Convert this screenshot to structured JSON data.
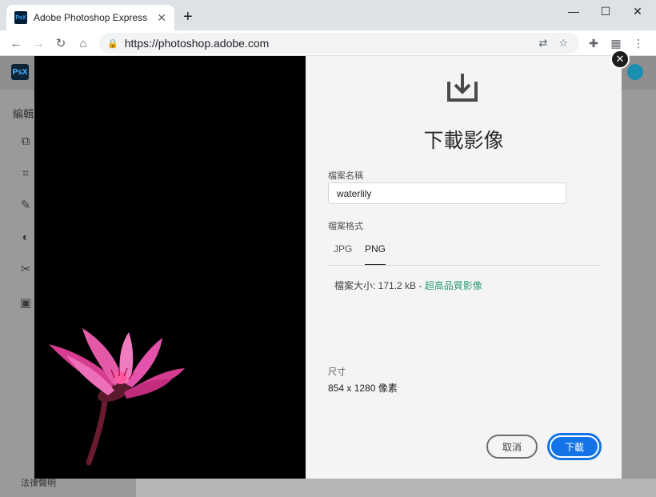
{
  "browser": {
    "tab_title": "Adobe Photoshop Express",
    "tab_favicon": "PsX",
    "new_tab": "+",
    "url": "https://photoshop.adobe.com",
    "window_controls": [
      "minimize-icon",
      "maximize-icon",
      "close-icon"
    ]
  },
  "app": {
    "logo": "PsX",
    "sidebar_heading": "編輯",
    "sidebar_icons": [
      "transform-icon",
      "crop-icon",
      "heal-icon",
      "adjust-icon",
      "cut-icon",
      "image-icon"
    ],
    "legal": "法律聲明"
  },
  "dialog": {
    "title": "下載影像",
    "filename_label": "檔案名稱",
    "filename_value": "waterlily",
    "format_label": "檔案格式",
    "formats": [
      "JPG",
      "PNG"
    ],
    "selected_format": "PNG",
    "size_label": "檔案大小: 171.2 kB - ",
    "size_quality": "超高品質影像",
    "dimensions_label": "尺寸",
    "dimensions_value": "854 x 1280 像素",
    "cancel_label": "取消",
    "download_label": "下載",
    "accent_color": "#1473e6"
  }
}
